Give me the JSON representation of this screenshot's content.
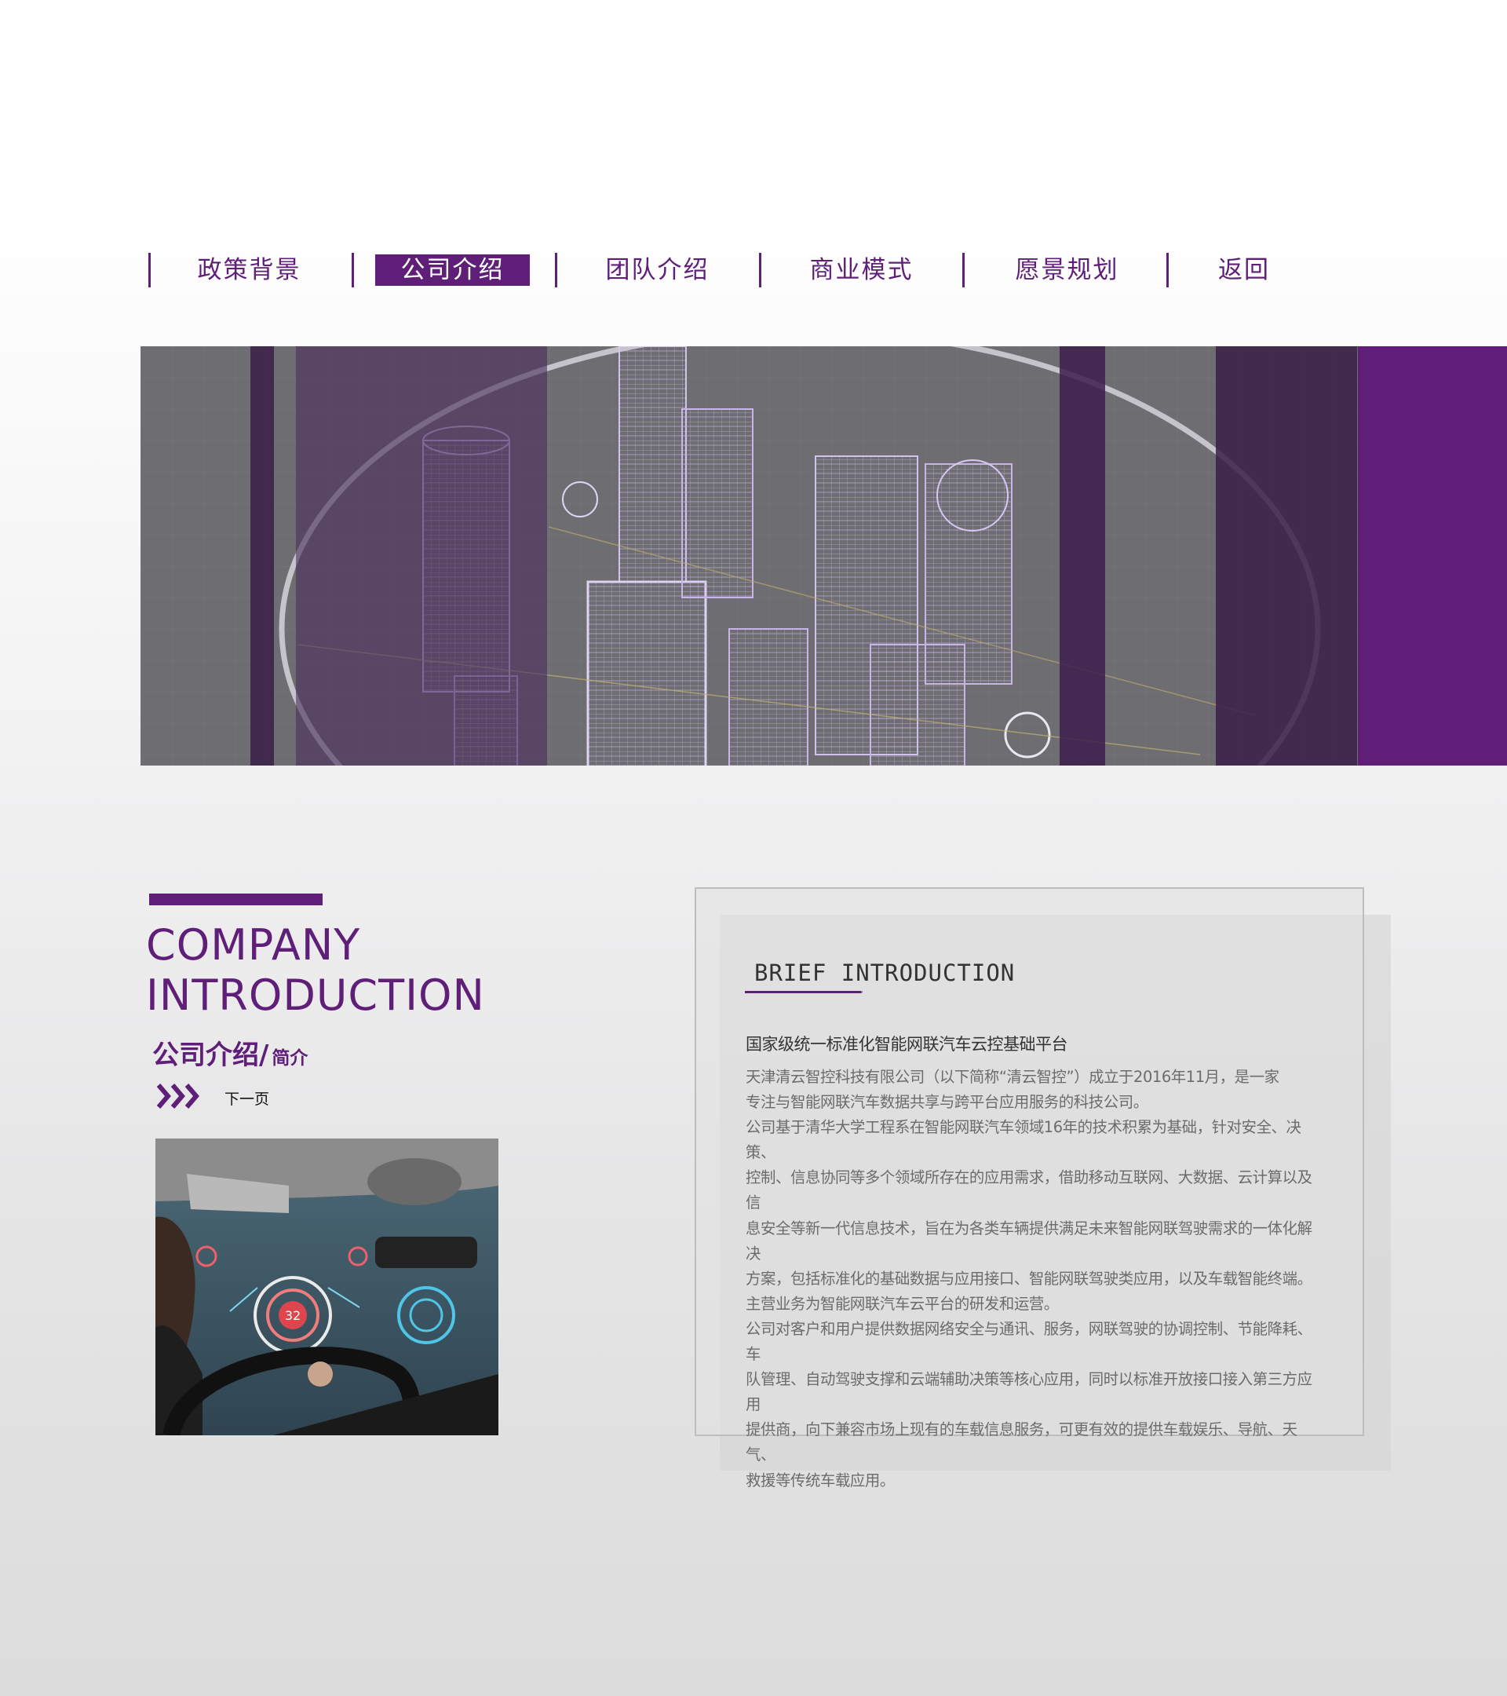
{
  "nav": {
    "items": [
      {
        "label": "政策背景",
        "active": false
      },
      {
        "label": "公司介绍",
        "active": true
      },
      {
        "label": "团队介绍",
        "active": false
      },
      {
        "label": "商业模式",
        "active": false
      },
      {
        "label": "愿景规划",
        "active": false
      },
      {
        "label": "返回",
        "active": false
      }
    ]
  },
  "hero": {
    "image": "hologram-city-wireframe",
    "accent_color": "#5f1f79"
  },
  "intro": {
    "title_en_line1": "COMPANY",
    "title_en_line2": "INTRODUCTION",
    "title_cn": "公司介绍/",
    "title_cn_sub": "简介",
    "next_label": "下一页",
    "next_icon": "triple-chevron-right-icon",
    "photo": "car-hud-driver-photo"
  },
  "brief": {
    "title": "BRIEF INTRODUCTION",
    "headline": "国家级统一标准化智能网联汽车云控基础平台",
    "lines": [
      "天津清云智控科技有限公司（以下简称“清云智控”）成立于2016年11月，是一家",
      "专注与智能网联汽车数据共享与跨平台应用服务的科技公司。",
      "公司基于清华大学工程系在智能网联汽车领域16年的技术积累为基础，针对安全、决策、",
      "控制、信息协同等多个领域所存在的应用需求，借助移动互联网、大数据、云计算以及信",
      "息安全等新一代信息技术，旨在为各类车辆提供满足未来智能网联驾驶需求的一体化解决",
      "方案，包括标准化的基础数据与应用接口、智能网联驾驶类应用，以及车载智能终端。",
      "主营业务为智能网联汽车云平台的研发和运营。",
      "公司对客户和用户提供数据网络安全与通讯、服务，网联驾驶的协调控制、节能降耗、车",
      "队管理、自动驾驶支撑和云端辅助决策等核心应用，同时以标准开放接口接入第三方应用",
      "提供商，向下兼容市场上现有的车载信息服务，可更有效的提供车载娱乐、导航、天气、",
      "救援等传统车载应用。"
    ]
  },
  "colors": {
    "brand_purple": "#5f1f79",
    "text_grey": "#6b6b6b",
    "heading_dark": "#333333"
  }
}
